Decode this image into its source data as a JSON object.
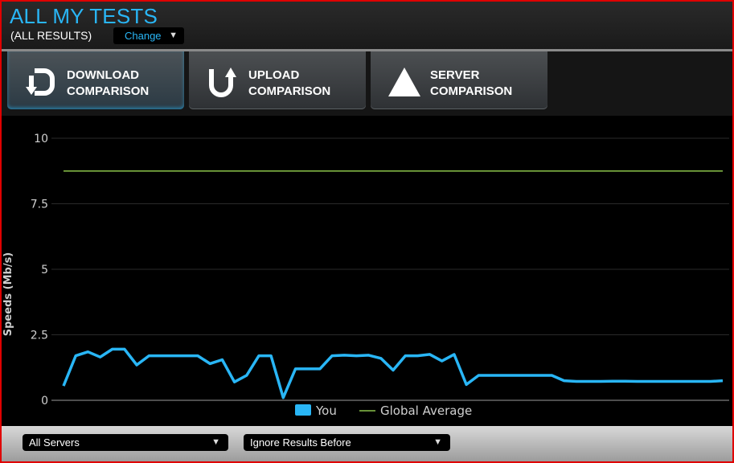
{
  "header": {
    "title": "ALL MY TESTS",
    "subtitle": "(ALL RESULTS)",
    "change_label": "Change",
    "accent_color": "#29b6f6"
  },
  "tabs": [
    {
      "line1": "DOWNLOAD",
      "line2": "COMPARISON",
      "icon": "download-arrow-icon",
      "active": true
    },
    {
      "line1": "UPLOAD",
      "line2": "COMPARISON",
      "icon": "upload-arrow-icon",
      "active": false
    },
    {
      "line1": "SERVER",
      "line2": "COMPARISON",
      "icon": "triangle-icon",
      "active": false
    }
  ],
  "chart_data": {
    "type": "line",
    "ylabel": "Speeds (Mb/s)",
    "xlabel": "",
    "ylim": [
      0,
      10
    ],
    "yticks": [
      "0",
      "2.5",
      "5",
      "7.5",
      "10"
    ],
    "grid": true,
    "legend_position": "bottom-center",
    "series": [
      {
        "name": "You",
        "color": "#29b6f6",
        "values": [
          0.55,
          1.7,
          1.85,
          1.65,
          1.95,
          1.95,
          1.35,
          1.7,
          1.7,
          1.7,
          1.7,
          1.7,
          1.4,
          1.55,
          0.7,
          0.95,
          1.7,
          1.7,
          0.1,
          1.2,
          1.2,
          1.2,
          1.7,
          1.72,
          1.7,
          1.72,
          1.6,
          1.15,
          1.7,
          1.7,
          1.75,
          1.5,
          1.75,
          0.6,
          0.95,
          0.95,
          0.95,
          0.95,
          0.95,
          0.95,
          0.95,
          0.75,
          0.72,
          0.72,
          0.72,
          0.73,
          0.73,
          0.72,
          0.72,
          0.72,
          0.72,
          0.72,
          0.72,
          0.72,
          0.75
        ]
      },
      {
        "name": "Global Average",
        "color": "#8bc34a",
        "values": [
          8.75
        ]
      }
    ]
  },
  "footer": {
    "servers_label": "All Servers",
    "ignore_label": "Ignore Results Before"
  }
}
